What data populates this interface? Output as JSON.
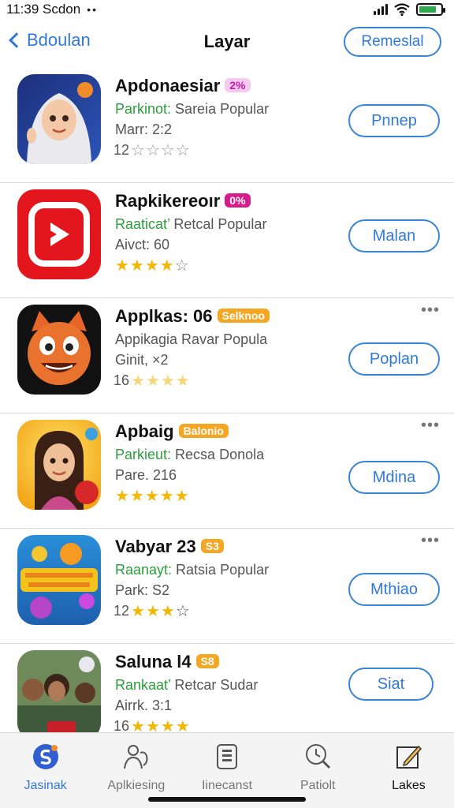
{
  "status_bar": {
    "time": "11:39 Scdon",
    "dots": "••"
  },
  "nav": {
    "back_label": "Bdoulan",
    "title": "Layar",
    "right_button": "Remeslal"
  },
  "apps": [
    {
      "name": "Apdonaesiar",
      "badge": "2%",
      "badge_bg": "#f6c9ef",
      "badge_fg": "#c81aa8",
      "sub_lead": "Parkinot:",
      "sub_rest": " Sareia Popular",
      "meta": "Marr: 2:2",
      "rating_num": "12",
      "stars_filled": "",
      "stars_empty": "☆☆☆☆",
      "star_color": "#999",
      "action": "Pnnep",
      "more": ""
    },
    {
      "name": "Rapkikereoır",
      "badge": "0%",
      "badge_bg": "#d81b8a",
      "badge_fg": "#ffffff",
      "sub_lead": "Raaticat’",
      "sub_rest": " Retcal Popular",
      "meta": "Aivct: 60",
      "rating_num": "",
      "stars_filled": "★★★★",
      "stars_empty": "☆",
      "star_color": "#f2b705",
      "action": "Malan",
      "more": ""
    },
    {
      "name": "Applkas: 06",
      "badge": "Selknoo",
      "badge_bg": "#f5a623",
      "badge_fg": "#ffffff",
      "sub_lead": "",
      "sub_rest": "Appikagia Ravar Popula",
      "meta": "Ginit, ×2",
      "rating_num": "16",
      "stars_filled": "★★★★",
      "stars_empty": "",
      "star_color": "#f7d67a",
      "action": "Poplan",
      "more": "•••"
    },
    {
      "name": "Apbaig",
      "badge": "Balonio",
      "badge_bg": "#f5a623",
      "badge_fg": "#ffffff",
      "sub_lead": "Parkieut:",
      "sub_rest": " Recsa Donola",
      "meta": "Pare. 216",
      "rating_num": "",
      "stars_filled": "★★★★★",
      "stars_empty": "",
      "star_color": "#f2b705",
      "action": "Mdina",
      "more": "•••"
    },
    {
      "name": "Vabyar 23",
      "badge": "S3",
      "badge_bg": "#f5a623",
      "badge_fg": "#ffffff",
      "sub_lead": "Raanayt:",
      "sub_rest": " Ratsia Popular",
      "meta": "Park: S2",
      "rating_num": "12",
      "stars_filled": "★★★",
      "stars_empty": "☆",
      "star_color": "#f2b705",
      "action": "Mthiao",
      "more": "•••"
    },
    {
      "name": "Saluna l4",
      "badge": "S8",
      "badge_bg": "#f5a623",
      "badge_fg": "#ffffff",
      "sub_lead": "Rankaat’",
      "sub_rest": " Retcar Sudar",
      "meta": "Airrk. 3:1",
      "rating_num": "16",
      "stars_filled": "★★★★",
      "stars_empty": "",
      "star_color": "#f2b705",
      "action": "Siat",
      "more": ""
    }
  ],
  "tabs": [
    {
      "label": "Jasinak",
      "icon": "globe-icon"
    },
    {
      "label": "Aplkiesing",
      "icon": "people-icon"
    },
    {
      "label": "Iinecanst",
      "icon": "document-icon"
    },
    {
      "label": "Patiolt",
      "icon": "search-icon"
    },
    {
      "label": "Lakes",
      "icon": "edit-icon"
    }
  ],
  "colors": {
    "accent": "#2f7ad8",
    "green": "#2a9d3a",
    "battery": "#2fa84f"
  }
}
